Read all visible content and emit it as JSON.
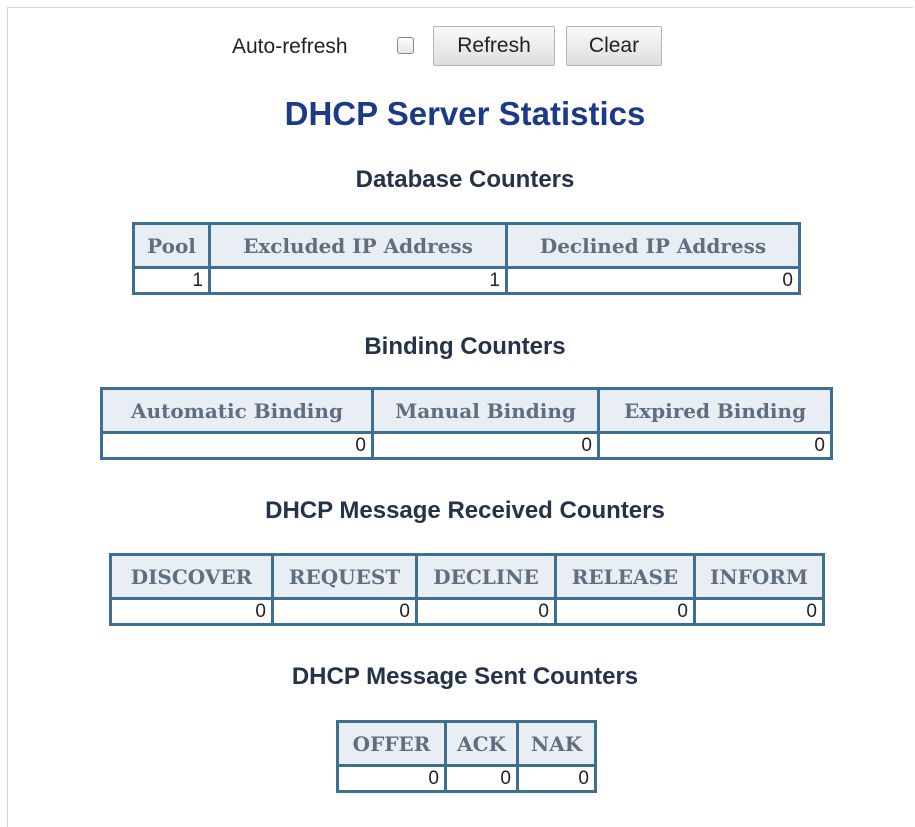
{
  "toolbar": {
    "auto_refresh_label": "Auto-refresh",
    "auto_refresh_checked": false,
    "refresh_label": "Refresh",
    "clear_label": "Clear"
  },
  "page_title": "DHCP Server Statistics",
  "database": {
    "title": "Database Counters",
    "headers": [
      "Pool",
      "Excluded IP Address",
      "Declined IP Address"
    ],
    "values": [
      "1",
      "1",
      "0"
    ]
  },
  "binding": {
    "title": "Binding Counters",
    "headers": [
      "Automatic Binding",
      "Manual Binding",
      "Expired Binding"
    ],
    "values": [
      "0",
      "0",
      "0"
    ]
  },
  "received": {
    "title": "DHCP Message Received Counters",
    "headers": [
      "DISCOVER",
      "REQUEST",
      "DECLINE",
      "RELEASE",
      "INFORM"
    ],
    "values": [
      "0",
      "0",
      "0",
      "0",
      "0"
    ]
  },
  "sent": {
    "title": "DHCP Message Sent Counters",
    "headers": [
      "OFFER",
      "ACK",
      "NAK"
    ],
    "values": [
      "0",
      "0",
      "0"
    ]
  },
  "colors": {
    "title": "#1b3a8a",
    "table_border": "#3e6f93",
    "header_bg": "#e9eef4",
    "header_text": "#5f6f7f"
  }
}
